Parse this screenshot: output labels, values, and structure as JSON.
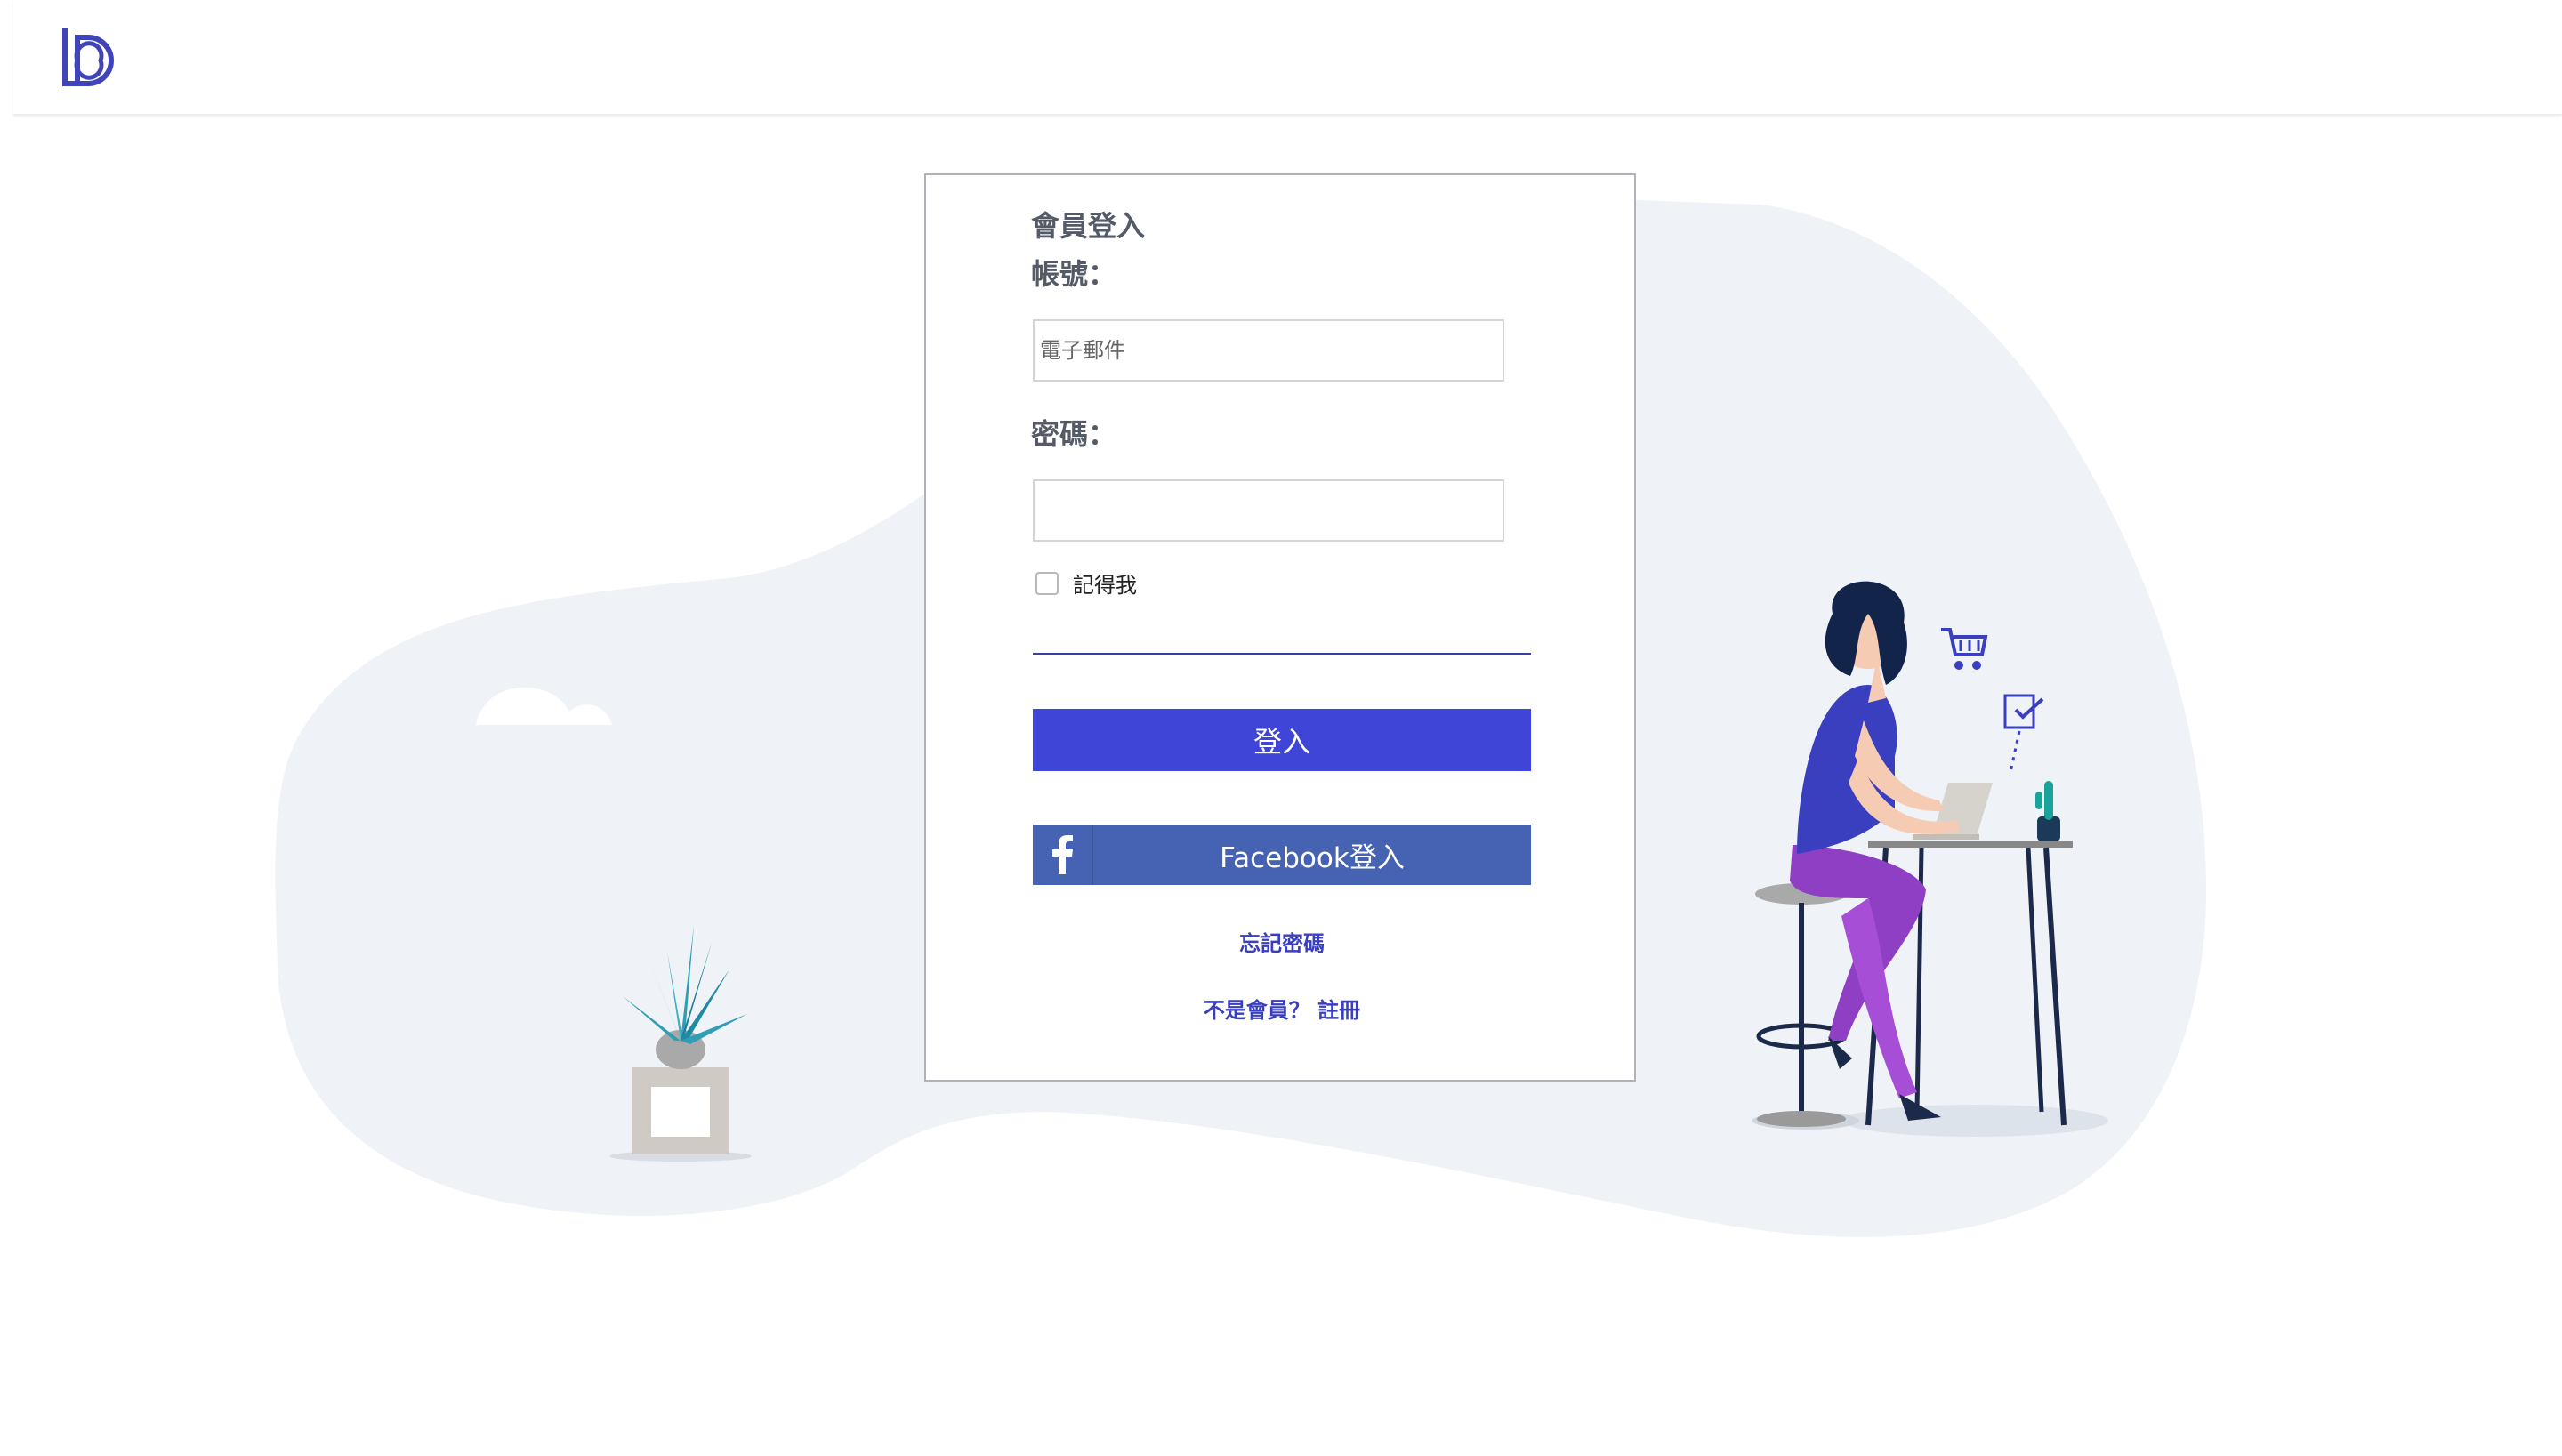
{
  "header": {
    "logo_icon": "brand-b-logo-icon"
  },
  "login": {
    "title": "會員登入",
    "account_label": "帳號：",
    "account_placeholder": "電子郵件",
    "password_label": "密碼：",
    "remember_label": "記得我",
    "login_button": "登入",
    "facebook_button": "Facebook登入",
    "forgot_password": "忘記密碼",
    "not_member": "不是會員？",
    "register": "註冊"
  },
  "colors": {
    "primary": "#3f45d6",
    "facebook": "#4662b2",
    "link": "#3a3fc0",
    "background_blob": "#eff2f7"
  }
}
